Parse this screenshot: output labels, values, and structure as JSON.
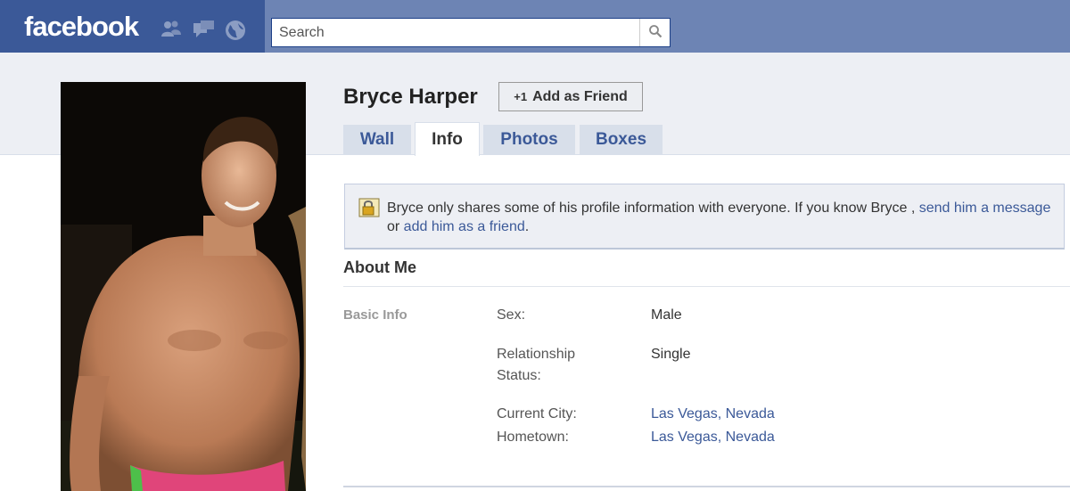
{
  "header": {
    "logo": "facebook",
    "search_placeholder": "Search"
  },
  "profile": {
    "name": "Bryce Harper",
    "add_friend_label": "Add as Friend",
    "add_friend_icon_text": "+1"
  },
  "tabs": [
    {
      "label": "Wall",
      "active": false
    },
    {
      "label": "Info",
      "active": true
    },
    {
      "label": "Photos",
      "active": false
    },
    {
      "label": "Boxes",
      "active": false
    }
  ],
  "notice": {
    "text_before": "Bryce only shares some of his profile information with everyone. If you know Bryce , ",
    "link_message": "send him a message",
    "text_middle": " or ",
    "link_friend": "add him as a friend",
    "text_after": "."
  },
  "about": {
    "title": "About Me",
    "basic_info_label": "Basic Info",
    "fields": [
      {
        "label": "Sex:",
        "value": "Male",
        "is_link": false
      },
      {
        "label": "Relationship Status:",
        "value": "Single",
        "is_link": false
      },
      {
        "label": "Current City:",
        "value": "Las Vegas, Nevada",
        "is_link": true
      },
      {
        "label": "Hometown:",
        "value": "Las Vegas, Nevada",
        "is_link": true
      }
    ]
  },
  "colors": {
    "brand_blue": "#3b5998",
    "header_light": "#6d84b4",
    "band_grey": "#edeff4"
  },
  "icons": [
    "friends-icon",
    "messages-icon",
    "notifications-globe-icon",
    "search-icon",
    "lock-icon",
    "add-friend-icon"
  ]
}
